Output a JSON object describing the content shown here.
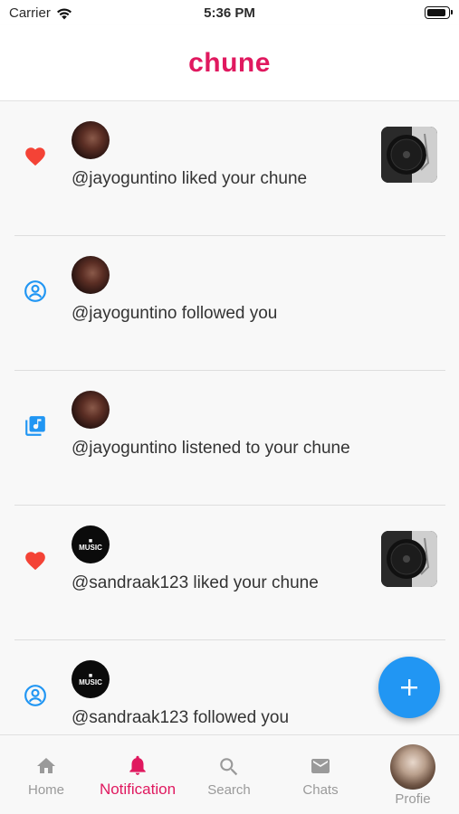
{
  "status_bar": {
    "carrier": "Carrier",
    "time": "5:36 PM"
  },
  "header": {
    "title": "chune"
  },
  "colors": {
    "brand": "#e0195f",
    "like": "#f44336",
    "follow": "#2196f3",
    "fab": "#2196f3"
  },
  "notifications": [
    {
      "type": "like",
      "icon": "heart-icon",
      "avatar": "user-photo",
      "text": "@jayoguntino liked your chune",
      "has_thumbnail": true
    },
    {
      "type": "follow",
      "icon": "account-circle-icon",
      "avatar": "user-photo",
      "text": "@jayoguntino followed you",
      "has_thumbnail": false
    },
    {
      "type": "listen",
      "icon": "library-music-icon",
      "avatar": "user-photo",
      "text": "@jayoguntino listened to your chune",
      "has_thumbnail": false
    },
    {
      "type": "like",
      "icon": "heart-icon",
      "avatar": "music-logo",
      "text": "@sandraak123 liked your chune",
      "has_thumbnail": true
    },
    {
      "type": "follow",
      "icon": "account-circle-icon",
      "avatar": "music-logo",
      "text": "@sandraak123 followed you",
      "has_thumbnail": false
    }
  ],
  "music_logo_text": "MUSIC",
  "fab": {
    "icon": "plus-icon"
  },
  "bottom_nav": {
    "active": "Notification",
    "items": [
      {
        "label": "Home",
        "icon": "home-icon"
      },
      {
        "label": "Notification",
        "icon": "bell-icon"
      },
      {
        "label": "Search",
        "icon": "search-icon"
      },
      {
        "label": "Chats",
        "icon": "mail-icon"
      },
      {
        "label": "Profie",
        "icon": "profile-avatar"
      }
    ]
  }
}
